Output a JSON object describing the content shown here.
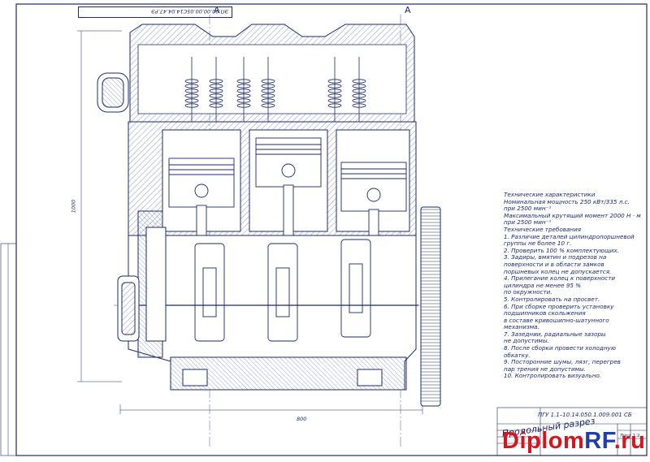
{
  "drawing": {
    "stamp_code": "ЭП.00.00.00.05С14.04.47.РЭ",
    "cut_marks": [
      "А",
      "А"
    ],
    "dimensions": {
      "width": "800",
      "height": "1000"
    },
    "specs_lines": [
      "Технические характеристики",
      "Номинальная мощность 250 кВт/335 л.с.",
      "  при 2500 мин⁻¹",
      "Максимальный крутящий момент 2000 Н · м",
      "при 2500 мин⁻¹",
      "  Технические требования",
      "1. Различие деталей цилиндропоршневой",
      "группы не более 10 г.",
      "2. Проверить 100 % комплектующих.",
      "3. Задиры, вмятин и подрезов на",
      "поверхности и в области замков",
      "поршневых колец не допускается.",
      "4. Прилегание колец к поверхности",
      "цилиндра не менее 95 %",
      "по окружности.",
      "5. Контролировать на просвет.",
      "6. При сборке проверить установку",
      " подшипников скольжения",
      "в составе кривошипно-шатунного",
      "механизма.",
      "7. Зазеднии, радиальные зазоры",
      "не допустимы.",
      "8. После сборки провести холодную",
      "обкатку.",
      "9. Посторонние шумы, лязг, перегрев",
      "пар трения не допустимы.",
      "10. Контролировать визуально."
    ],
    "title_block": {
      "code": "ПГУ 1.1–10.14.050.1.009.001 СБ",
      "title": "Продольный разрез",
      "sheet_label": "Лист",
      "scale_label": "1:2"
    },
    "watermark": {
      "part1": "Diplom",
      "part2": "RF",
      "part3": ".ru"
    }
  },
  "colors": {
    "line": "#1b2a6b",
    "hatch": "#4a5a9a",
    "watermark_red": "#d5161d",
    "watermark_blue": "#1f3fa8"
  }
}
